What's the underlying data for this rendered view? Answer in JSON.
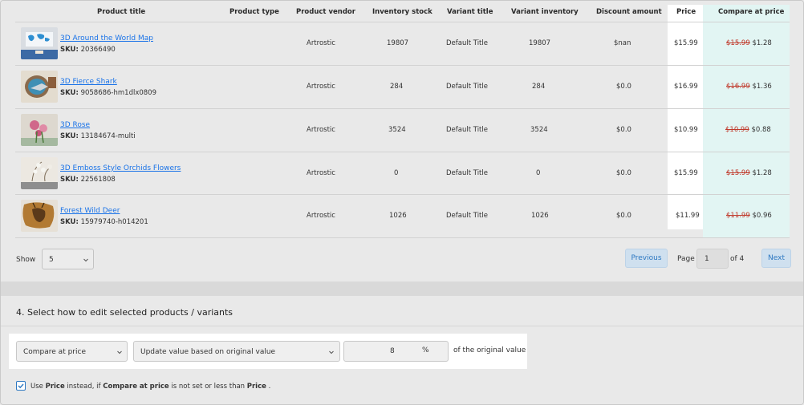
{
  "table": {
    "headers": {
      "product_title": "Product title",
      "product_type": "Product type",
      "product_vendor": "Product vendor",
      "inventory_stock": "Inventory stock",
      "variant_title": "Variant title",
      "variant_inventory": "Variant inventory",
      "discount_amount": "Discount amount",
      "price": "Price",
      "compare_at_price": "Compare at price"
    },
    "sku_label": "SKU:",
    "rows": [
      {
        "title": "3D Around the World Map",
        "sku": "20366490",
        "type": "",
        "vendor": "Artrostic",
        "stock": "19807",
        "variant_title": "Default Title",
        "variant_inventory": "19807",
        "discount": "$nan",
        "price": "$15.99",
        "compare_old": "$15.99",
        "compare_new": "$1.28",
        "thumb": "world-map"
      },
      {
        "title": "3D Fierce Shark",
        "sku": "9058686-hm1dlx0809",
        "type": "",
        "vendor": "Artrostic",
        "stock": "284",
        "variant_title": "Default Title",
        "variant_inventory": "284",
        "discount": "$0.0",
        "price": "$16.99",
        "compare_old": "$16.99",
        "compare_new": "$1.36",
        "thumb": "shark"
      },
      {
        "title": "3D Rose",
        "sku": "13184674-multi",
        "type": "",
        "vendor": "Artrostic",
        "stock": "3524",
        "variant_title": "Default Title",
        "variant_inventory": "3524",
        "discount": "$0.0",
        "price": "$10.99",
        "compare_old": "$10.99",
        "compare_new": "$0.88",
        "thumb": "rose"
      },
      {
        "title": "3D Emboss Style Orchids Flowers",
        "sku": "22561808",
        "type": "",
        "vendor": "Artrostic",
        "stock": "0",
        "variant_title": "Default Title",
        "variant_inventory": "0",
        "discount": "$0.0",
        "price": "$15.99",
        "compare_old": "$15.99",
        "compare_new": "$1.28",
        "thumb": "orchids"
      },
      {
        "title": "Forest Wild Deer",
        "sku": "15979740-h014201",
        "type": "",
        "vendor": "Artrostic",
        "stock": "1026",
        "variant_title": "Default Title",
        "variant_inventory": "1026",
        "discount": "$0.0",
        "price": "$11.99",
        "compare_old": "$11.99",
        "compare_new": "$0.96",
        "thumb": "deer"
      }
    ]
  },
  "pagination": {
    "show_label": "Show",
    "show_value": "5",
    "previous": "Previous",
    "page_label": "Page",
    "page_value": "1",
    "of_label": "of 4",
    "next": "Next"
  },
  "edit_section": {
    "title": "4. Select how to edit selected products / variants",
    "field_select": "Compare at price",
    "method_select": "Update value based on original value",
    "amount": "8",
    "unit": "%",
    "suffix": "of the original value",
    "checkbox_checked": true,
    "note": {
      "t1": "Use ",
      "b1": "Price",
      "t2": " instead, if ",
      "b2": "Compare at price",
      "t3": " is not set or less than ",
      "b3": "Price",
      "t4": " ."
    }
  },
  "colors": {
    "link": "#1a73e8",
    "strike": "#c0392b",
    "button_bg": "#cfe0ef",
    "button_text": "#2d78c2",
    "compare_highlight": "#e2f5f3"
  }
}
